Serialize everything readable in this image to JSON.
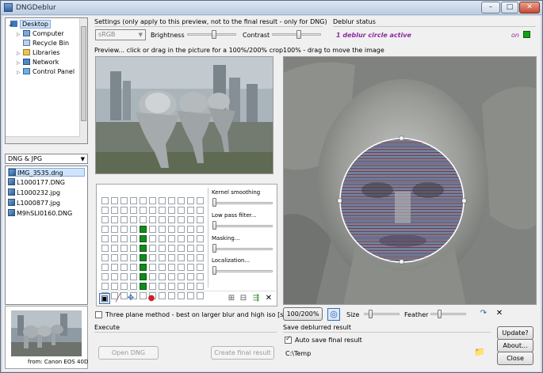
{
  "window": {
    "title": "DNGDeblur",
    "minimize": "–",
    "maximize": "□",
    "close": "✕"
  },
  "tree": {
    "items": [
      {
        "label": "Desktop",
        "icon": "desktop-icon"
      },
      {
        "label": "Computer",
        "icon": "computer-icon"
      },
      {
        "label": "Recycle Bin",
        "icon": "recycle-bin-icon"
      },
      {
        "label": "Libraries",
        "icon": "libraries-icon"
      },
      {
        "label": "Network",
        "icon": "network-icon"
      },
      {
        "label": "Control Panel",
        "icon": "control-panel-icon"
      }
    ]
  },
  "filter": {
    "value": "DNG & JPG"
  },
  "files": [
    "IMG_3535.dng",
    "L1000177.DNG",
    "L1000232.jpg",
    "L1000877.jpg",
    "M9hSLI0160.DNG"
  ],
  "thumbnail": {
    "caption": "from: Canon EOS 40D"
  },
  "settings": {
    "header": "Settings (only apply to this preview, not to the final result - only for DNG)",
    "colorspace": "sRGB",
    "brightness_label": "Brightness",
    "contrast_label": "Contrast",
    "brightness_level": 0.55,
    "contrast_level": 0.55
  },
  "status": {
    "header": "Deblur status",
    "text": "1 deblur circle active",
    "on_label": "on",
    "on_color": "#13a013",
    "text_color": "#8a2a9e"
  },
  "preview": {
    "header": "Preview... click or drag in the picture for a 100%/200% crop"
  },
  "zoom": {
    "header": "100% - drag to move the image",
    "button": "100/200%",
    "size_label": "Size",
    "feather_label": "Feather"
  },
  "kernel": {
    "sliders": [
      {
        "label": "Kernel smoothing"
      },
      {
        "label": "Low pass filter..."
      },
      {
        "label": "Masking..."
      },
      {
        "label": "Localization..."
      }
    ],
    "active_cells": [
      [
        4,
        3
      ],
      [
        4,
        4
      ],
      [
        4,
        5
      ],
      [
        4,
        6
      ],
      [
        4,
        7
      ],
      [
        4,
        8
      ],
      [
        4,
        9
      ]
    ]
  },
  "options": {
    "three_plane": "Three plane method - best on larger blur and high iso [slow]"
  },
  "execute": {
    "header": "Execute",
    "open_dng": "Open DNG",
    "create_result": "Create final result"
  },
  "save": {
    "header": "Save deblurred result",
    "auto_save": "Auto save final result",
    "path": "C:\\Temp"
  },
  "actions": {
    "update": "Update?",
    "about": "About...",
    "close": "Close"
  }
}
